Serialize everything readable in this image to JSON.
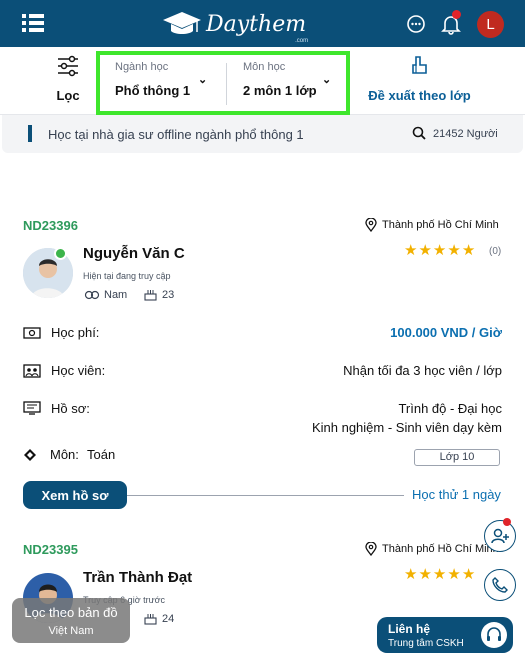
{
  "header": {
    "logo_text": "Daythem",
    "logo_sub": ".com",
    "avatar_letter": "L",
    "icons": [
      "menu-icon",
      "chat-icon",
      "bell-icon"
    ]
  },
  "filters": {
    "loc_label": "Lọc",
    "nganh_caption": "Ngành học",
    "nganh_value": "Phổ thông 1",
    "mon_caption": "Môn học",
    "mon_value": "2 môn 1 lớp",
    "suggest_label": "Đề xuất theo lớp"
  },
  "strip": {
    "text": "Học tại nhà gia sư offline ngành phổ thông 1",
    "count": "21452 Người"
  },
  "cards": [
    {
      "code": "ND23396",
      "city": "Thành phố Hồ Chí Minh",
      "name": "Nguyễn Văn C",
      "status": "Hiện tại đang truy cập",
      "gender": "Nam",
      "age": "23",
      "rating_count": "(0)",
      "stars": 5,
      "fee_label": "Học phí:",
      "fee_value": "100.000 VND / Giờ",
      "students_label": "Học viên:",
      "students_value": "Nhận tối đa 3 học viên / lớp",
      "profile_label": "Hồ sơ:",
      "profile_line1": "Trình độ - Đại học",
      "profile_line2": "Kinh nghiệm - Sinh viên dạy kèm",
      "subject_label": "Môn:",
      "subject_value": "Toán",
      "grade": "Lớp 10",
      "view_button": "Xem hồ sơ",
      "trial": "Học thử 1 ngày"
    },
    {
      "code": "ND23395",
      "city": "Thành phố Hồ Chí Minh",
      "name": "Trần Thành Đạt",
      "status": "Truy cập 6 giờ trước",
      "age": "24",
      "stars": 5
    }
  ],
  "floating": {
    "map_title": "Lọc theo bản đồ",
    "map_sub": "Việt Nam",
    "contact_title": "Liên hệ",
    "contact_sub": "Trung tâm CSKH"
  },
  "colors": {
    "brand": "#0b4f78",
    "accent_green": "#3ee62c",
    "code_green": "#2e9a5c",
    "star": "#f2b100",
    "link": "#0b6fb0"
  }
}
